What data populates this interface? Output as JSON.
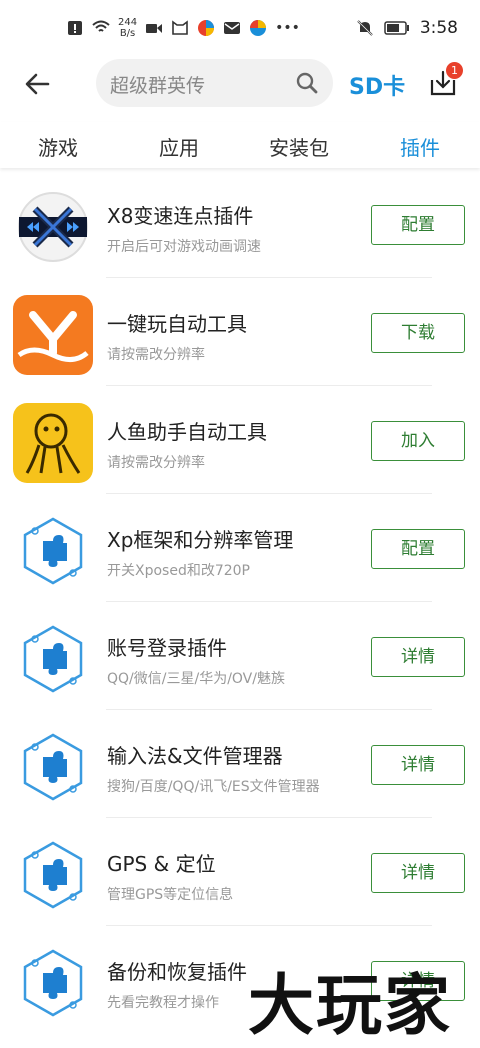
{
  "status_bar": {
    "speed_value": "244",
    "speed_unit": "B/s",
    "time": "3:58"
  },
  "header": {
    "search_placeholder": "超级群英传",
    "sd_label": "SD卡",
    "download_badge": "1"
  },
  "tabs": [
    {
      "label": "游戏",
      "active": false
    },
    {
      "label": "应用",
      "active": false
    },
    {
      "label": "安装包",
      "active": false
    },
    {
      "label": "插件",
      "active": true
    }
  ],
  "items": [
    {
      "title": "X8变速连点插件",
      "subtitle": "开启后可对游戏动画调速",
      "button": "配置",
      "icon": "x8-icon"
    },
    {
      "title": "一键玩自动工具",
      "subtitle": "请按需改分辨率",
      "button": "下载",
      "icon": "y-orange-icon"
    },
    {
      "title": "人鱼助手自动工具",
      "subtitle": "请按需改分辨率",
      "button": "加入",
      "icon": "mermaid-icon"
    },
    {
      "title": "Xp框架和分辨率管理",
      "subtitle": "开关Xposed和改720P",
      "button": "配置",
      "icon": "puzzle-hex-icon"
    },
    {
      "title": "账号登录插件",
      "subtitle": "QQ/微信/三星/华为/OV/魅族",
      "button": "详情",
      "icon": "puzzle-hex-icon"
    },
    {
      "title": "输入法&文件管理器",
      "subtitle": "搜狗/百度/QQ/讯飞/ES文件管理器",
      "button": "详情",
      "icon": "puzzle-hex-icon"
    },
    {
      "title": "GPS & 定位",
      "subtitle": "管理GPS等定位信息",
      "button": "详情",
      "icon": "puzzle-hex-icon"
    },
    {
      "title": "备份和恢复插件",
      "subtitle": "先看完教程才操作",
      "button": "详情",
      "icon": "puzzle-hex-icon"
    }
  ],
  "watermark": "大玩家",
  "colors": {
    "accent": "#1a8fd9",
    "button_border": "#3a8f3a",
    "badge": "#e8402b"
  }
}
